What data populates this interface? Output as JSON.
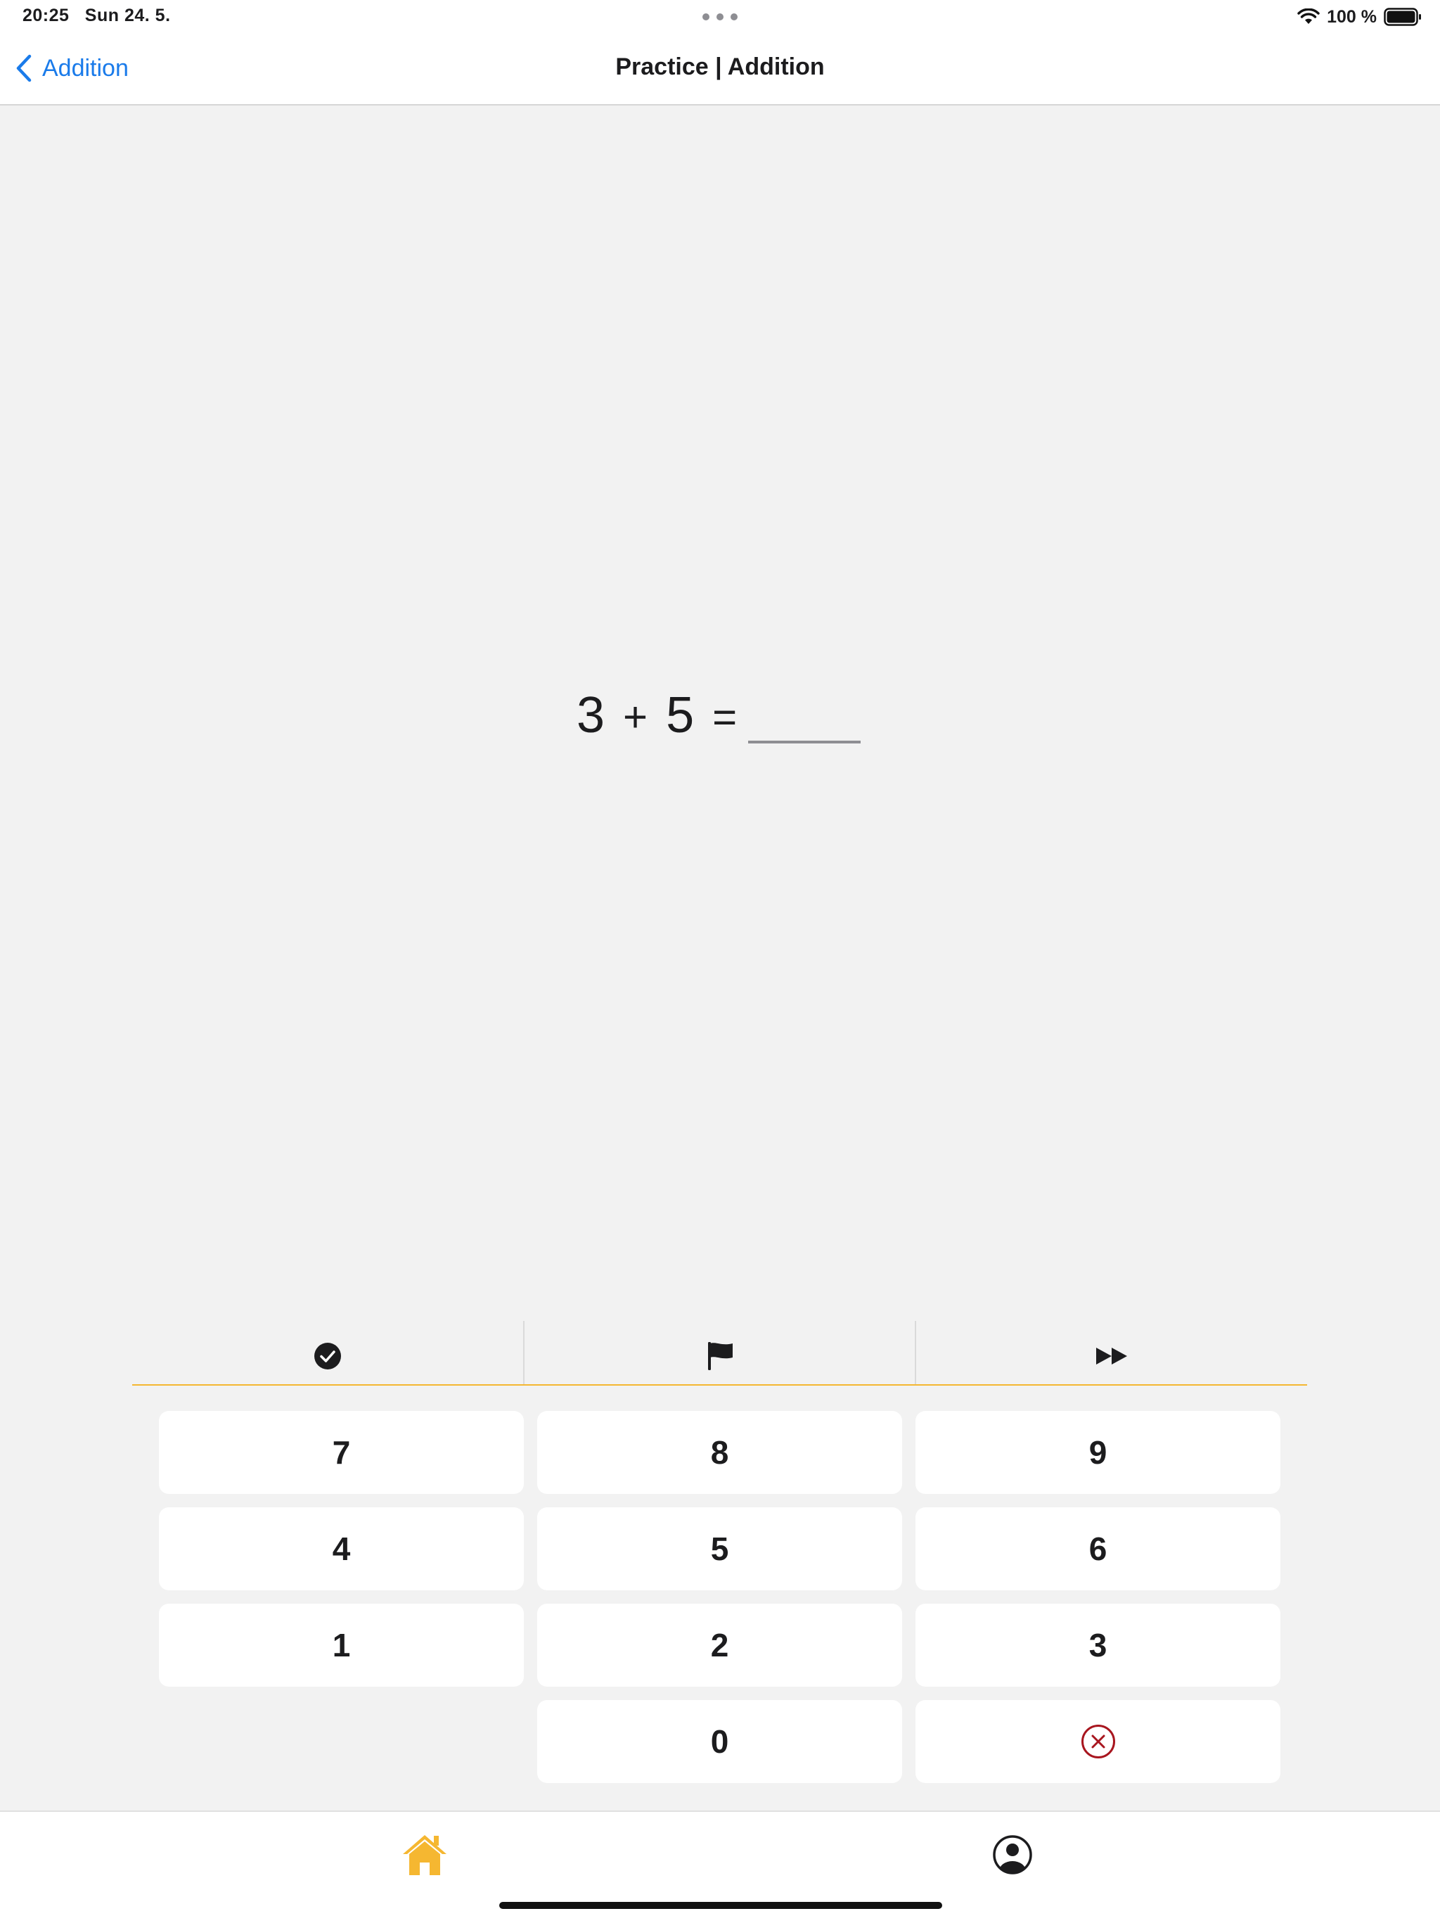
{
  "status_bar": {
    "time": "20:25",
    "date": "Sun 24. 5.",
    "battery": "100 %"
  },
  "nav": {
    "back_label": "Addition",
    "title": "Practice | Addition"
  },
  "problem": {
    "operand_a": "3",
    "operator": "+",
    "operand_b": "5",
    "equals": "=",
    "answer": ""
  },
  "toolbar": {
    "icons": [
      "check-circle-icon",
      "flag-icon",
      "fast-forward-icon"
    ]
  },
  "keypad": {
    "keys": [
      "7",
      "8",
      "9",
      "4",
      "5",
      "6",
      "1",
      "2",
      "3",
      "0"
    ],
    "delete_icon": "delete-circle-x-icon",
    "delete_color": "#a8161f"
  },
  "tabs": {
    "icons": [
      "home-icon",
      "profile-icon"
    ],
    "active_color": "#f5b731"
  },
  "colors": {
    "accent_blue": "#1a7bea",
    "accent_yellow": "#f5b731",
    "background": "#f2f2f2"
  }
}
